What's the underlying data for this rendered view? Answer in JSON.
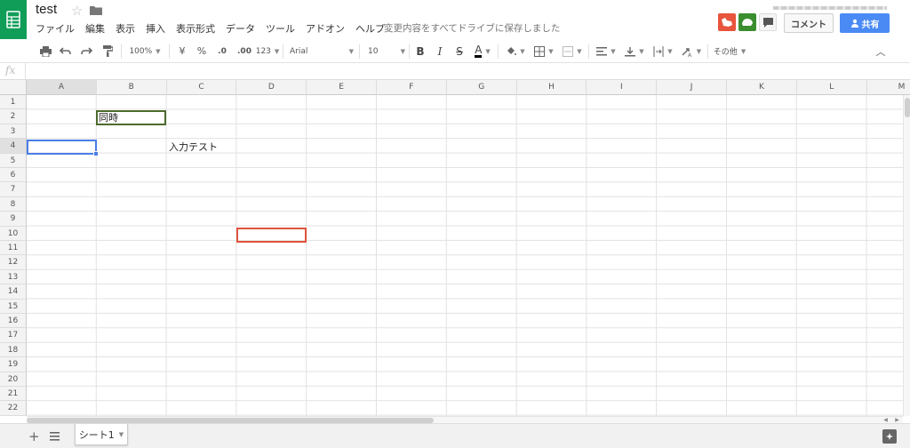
{
  "header": {
    "title": "test",
    "menu": [
      "ファイル",
      "編集",
      "表示",
      "挿入",
      "表示形式",
      "データ",
      "ツール",
      "アドオン",
      "ヘルプ"
    ],
    "save_status": "変更内容をすべてドライブに保存しました",
    "comment_label": "コメント",
    "share_label": "共有"
  },
  "toolbar": {
    "zoom": "100%",
    "currency": "¥",
    "percent": "%",
    "decimal_decrease": ".0",
    "decimal_increase": ".00",
    "number_format": "123",
    "font": "Arial",
    "font_size": "10",
    "bold": "B",
    "italic": "I",
    "strikethrough": "S",
    "text_color": "A",
    "more": "その他"
  },
  "formula_bar": {
    "label": "fx",
    "value": ""
  },
  "grid": {
    "columns": [
      "A",
      "B",
      "C",
      "D",
      "E",
      "F",
      "G",
      "H",
      "I",
      "J",
      "K",
      "L",
      "M"
    ],
    "rows": [
      "1",
      "2",
      "3",
      "4",
      "5",
      "6",
      "7",
      "8",
      "9",
      "10",
      "11",
      "12",
      "13",
      "14",
      "15",
      "16",
      "17",
      "18",
      "19",
      "20",
      "21",
      "22"
    ],
    "cells": {
      "B2": "同時",
      "C4": "入力テスト"
    },
    "active_cell": "A4"
  },
  "sheets": {
    "tabs": [
      "シート1"
    ]
  },
  "colors": {
    "sheets_green": "#0f9d58",
    "share_blue": "#4a8af4",
    "selection_blue": "#4a7ee6",
    "collaborator_green": "#4c6b2d",
    "collaborator_red": "#e0533c"
  }
}
